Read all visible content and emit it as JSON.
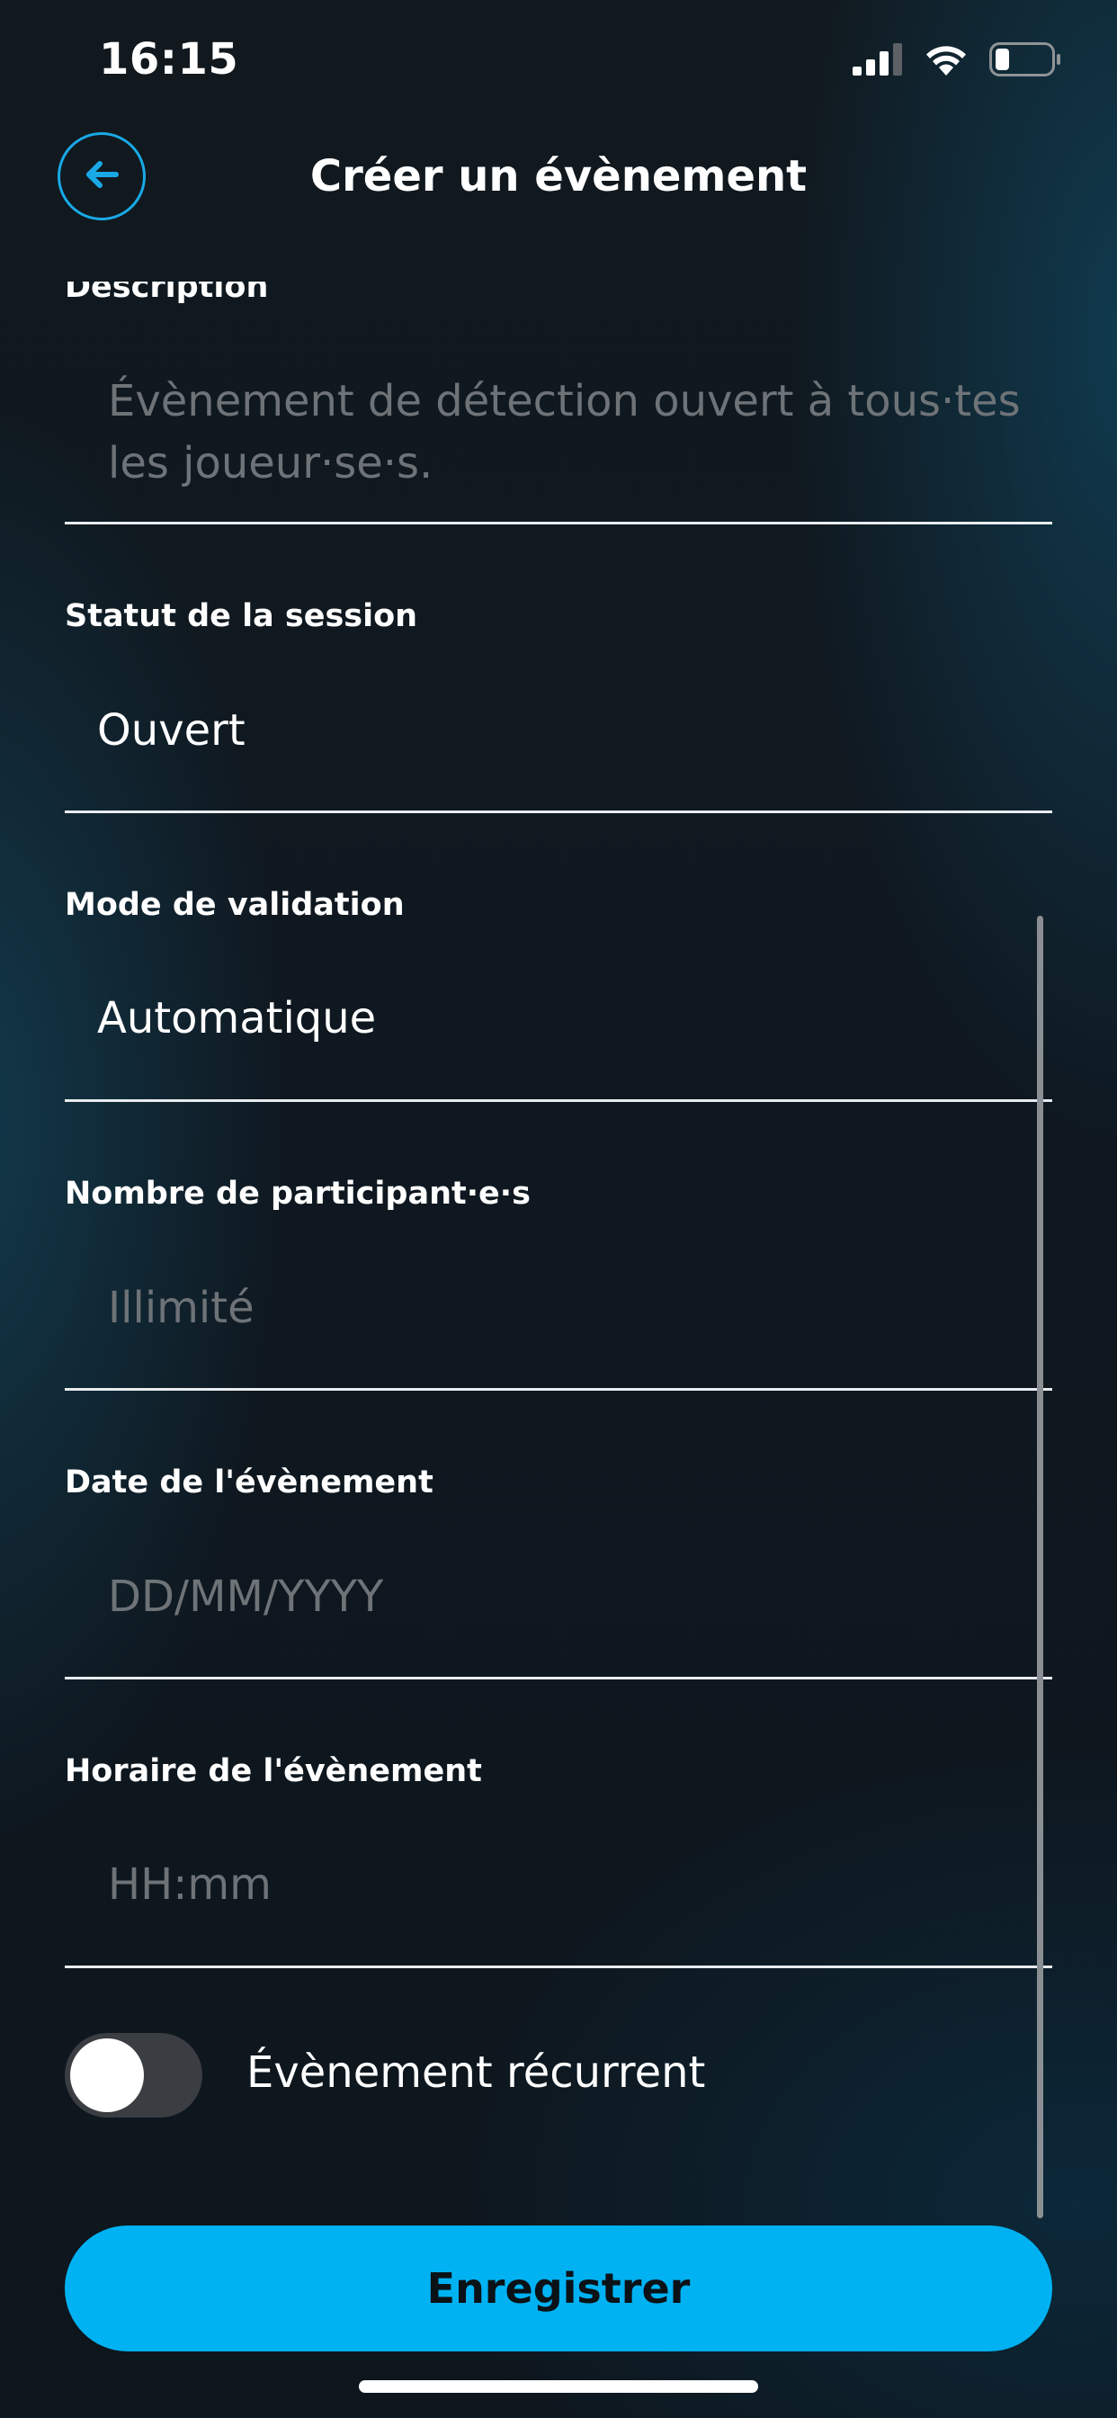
{
  "status_bar": {
    "time": "16:15",
    "icons": [
      "cellular-signal-icon",
      "wifi-icon",
      "battery-icon"
    ]
  },
  "header": {
    "title": "Créer un évènement",
    "back_icon": "arrow-left-icon"
  },
  "form": {
    "description": {
      "label": "Description",
      "placeholder": "Évènement de détection ouvert à tous·tes les joueur·se·s."
    },
    "session_status": {
      "label": "Statut de la session",
      "value": "Ouvert"
    },
    "validation_mode": {
      "label": "Mode de validation",
      "value": "Automatique"
    },
    "participants": {
      "label": "Nombre de participant·e·s",
      "placeholder": "Illimité"
    },
    "event_date": {
      "label": "Date de l'évènement",
      "placeholder": "DD/MM/YYYY"
    },
    "event_time": {
      "label": "Horaire de l'évènement",
      "placeholder": "HH:mm"
    },
    "recurring": {
      "label": "Évènement récurrent",
      "enabled": false
    }
  },
  "actions": {
    "save_label": "Enregistrer"
  },
  "colors": {
    "accent": "#00b2f2",
    "back_button_border": "#19a9e6",
    "placeholder_text": "#6e7377",
    "toggle_off": "#3a3d41"
  }
}
